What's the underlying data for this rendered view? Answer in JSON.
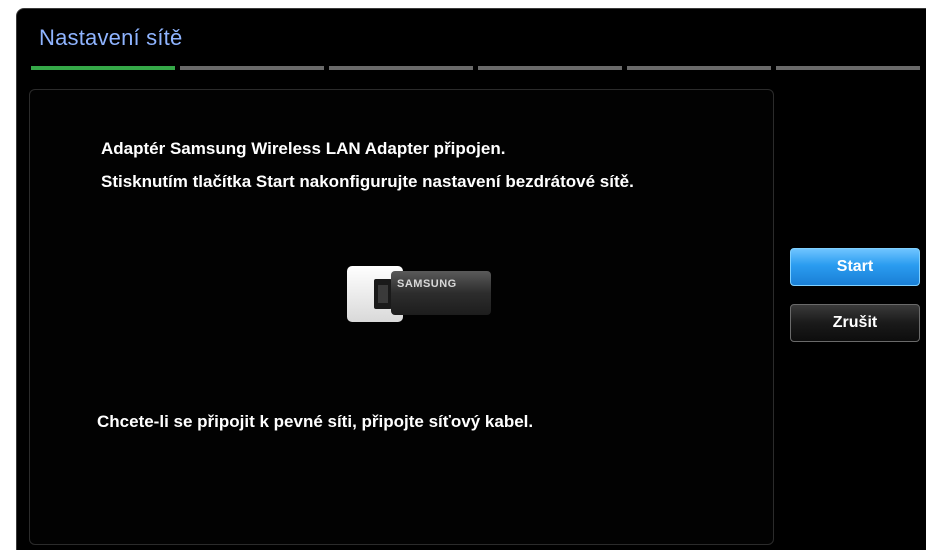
{
  "window": {
    "title": "Nastavení sítě",
    "steps_total": 6,
    "steps_active_index": 0
  },
  "panel": {
    "line1": "Adaptér Samsung Wireless LAN Adapter připojen.",
    "line2": "Stisknutím tlačítka Start nakonfigurujte nastavení bezdrátové sítě.",
    "line3": "Chcete-li se připojit k pevné síti, připojte síťový kabel.",
    "adapter_brand": "SAMSUNG"
  },
  "buttons": {
    "start_label": "Start",
    "cancel_label": "Zrušit"
  },
  "colors": {
    "title": "#8fb4ff",
    "step_active": "#35a848",
    "step_inactive": "#6a6a6a",
    "start_button": "#2a9cf0"
  }
}
